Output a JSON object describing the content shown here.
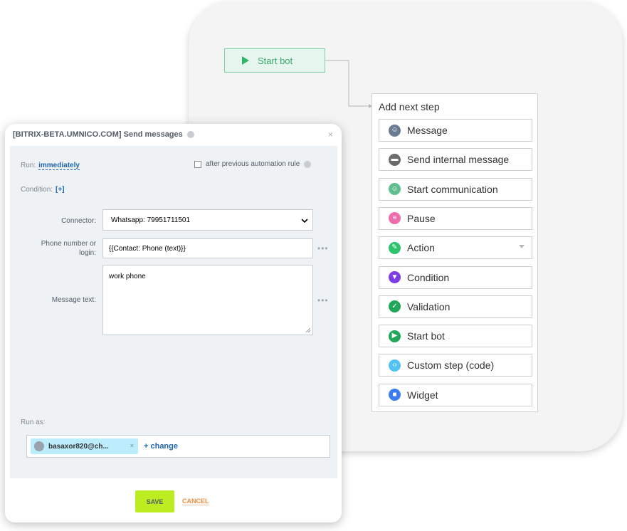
{
  "builder": {
    "start_node_label": "Start bot",
    "panel_title": "Add next step",
    "steps": [
      {
        "label": "Message",
        "color": "#6a7c94",
        "icon": "robot-icon"
      },
      {
        "label": "Send internal message",
        "color": "#6b6b6b",
        "icon": "chat-bubble-icon"
      },
      {
        "label": "Start communication",
        "color": "#5fbf8f",
        "icon": "robot-share-icon"
      },
      {
        "label": "Pause",
        "color": "#f06dad",
        "icon": "pause-bubble-icon"
      },
      {
        "label": "Action",
        "color": "#2fc36e",
        "icon": "pencil-icon"
      },
      {
        "label": "Condition",
        "color": "#7e3ee5",
        "icon": "funnel-icon"
      },
      {
        "label": "Validation",
        "color": "#22a659",
        "icon": "check-icon"
      },
      {
        "label": "Start bot",
        "color": "#22a659",
        "icon": "play-icon"
      },
      {
        "label": "Custom step (code)",
        "color": "#52c2f2",
        "icon": "code-icon"
      },
      {
        "label": "Widget",
        "color": "#3c7cf0",
        "icon": "widget-icon"
      }
    ]
  },
  "dialog": {
    "title": "[BITRIX-BETA.UMNICO.COM] Send messages",
    "run_label": "Run:",
    "run_value": "immediately",
    "after_previous_label": "after previous automation rule",
    "condition_label": "Condition:",
    "condition_add": "[+]",
    "connector_label": "Connector:",
    "connector_value": "Whatsapp: 79951711501",
    "phone_label_1": "Phone number or",
    "phone_label_2": "login:",
    "phone_value": "{{Contact: Phone (text)}}",
    "message_label": "Message text:",
    "message_value": "work phone",
    "dots": "•••",
    "run_as_label": "Run as:",
    "run_as_user": "basaxor820@ch...",
    "change_link": "+ change",
    "save_label": "SAVE",
    "cancel_label": "CANCEL",
    "close_symbol": "×",
    "chip_remove": "×"
  },
  "colors": {
    "accent_blue": "#2067b0",
    "save_green": "#bbed21",
    "cancel_orange": "#f08c3c",
    "start_green": "#2fb568"
  }
}
